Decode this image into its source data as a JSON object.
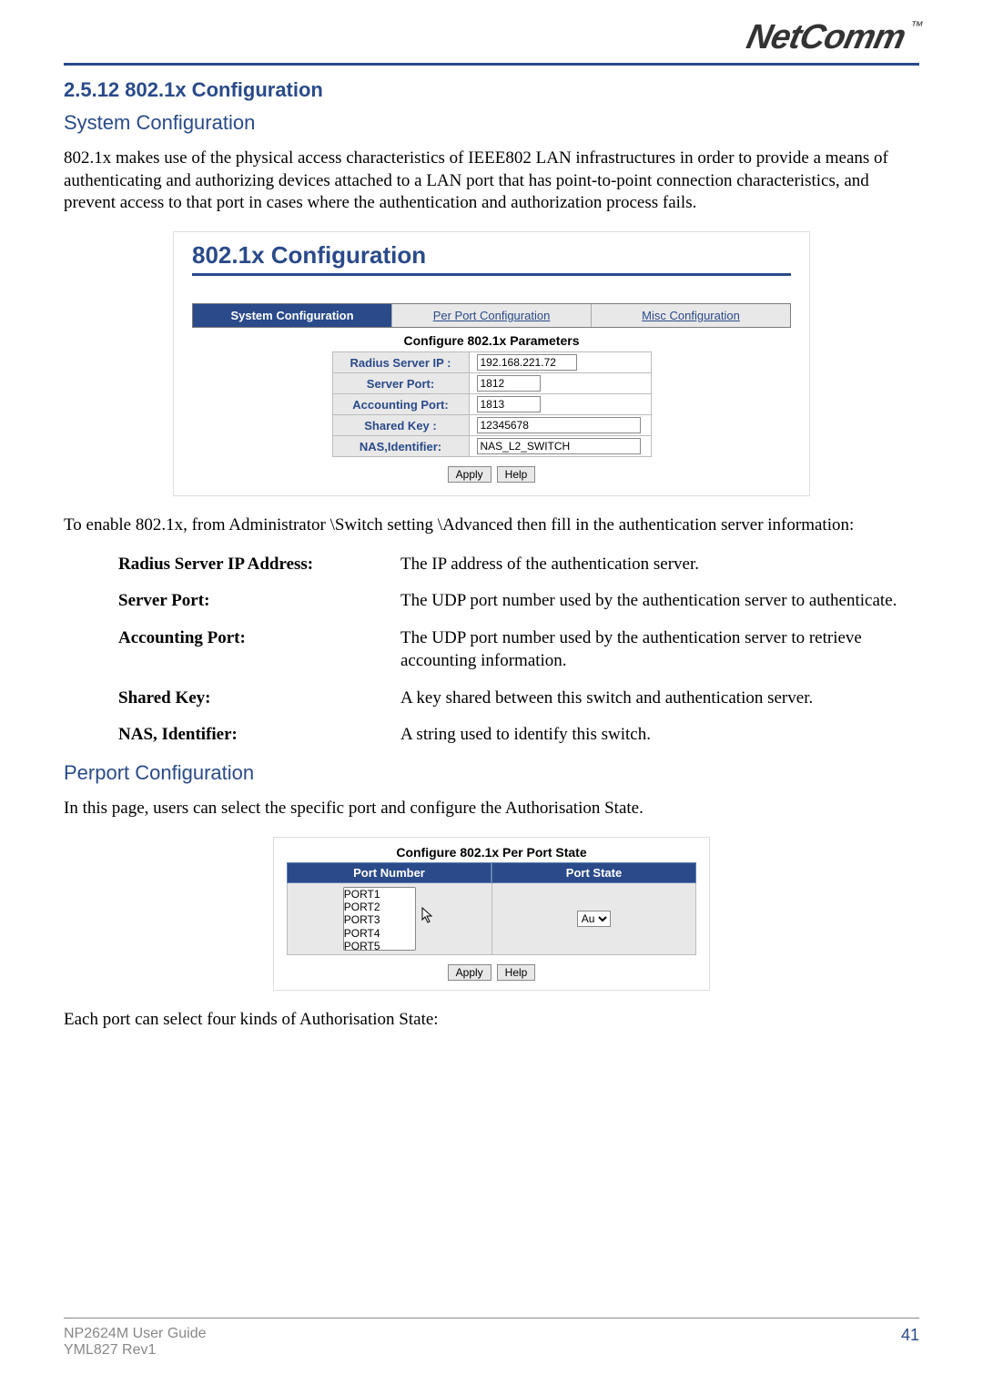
{
  "brand": {
    "name": "NetComm",
    "tm": "™"
  },
  "section": {
    "number_title": "2.5.12  802.1x Configuration"
  },
  "sys_config": {
    "heading": "System Configuration",
    "intro": "802.1x makes use of the physical access characteristics of IEEE802 LAN infrastructures in order to provide a means of authenticating and authorizing devices attached to a LAN port that has point-to-point connection characteristics, and prevent access to that port in cases where the authentication and authorization process fails.",
    "panel_title": "802.1x Configuration",
    "tabs": {
      "system": "System Configuration",
      "perport": "Per Port Configuration",
      "misc": "Misc Configuration"
    },
    "params_caption": "Configure 802.1x Parameters",
    "fields": {
      "radius_ip": {
        "label": "Radius Server IP :",
        "value": "192.168.221.72"
      },
      "server_port": {
        "label": "Server Port:",
        "value": "1812"
      },
      "accounting_port": {
        "label": "Accounting Port:",
        "value": "1813"
      },
      "shared_key": {
        "label": "Shared Key :",
        "value": "12345678"
      },
      "nas_identifier": {
        "label": "NAS,Identifier:",
        "value": "NAS_L2_SWITCH"
      }
    },
    "buttons": {
      "apply": "Apply",
      "help": "Help"
    },
    "post_text": "To enable 802.1x, from Administrator \\Switch setting \\Advanced then fill in the authentication server information:",
    "defs": [
      {
        "term": "Radius Server IP Address:",
        "desc": "The IP address of the authentication server."
      },
      {
        "term": "Server Port:",
        "desc": "The UDP port number used by the authentication server to authenticate."
      },
      {
        "term": "Accounting Port:",
        "desc": "The UDP port number used by the authentication server to retrieve accounting information."
      },
      {
        "term": "Shared Key:",
        "desc": "A key shared between this switch and authentication server."
      },
      {
        "term": "NAS, Identifier:",
        "desc": "A string used to identify this switch."
      }
    ]
  },
  "perport": {
    "heading": "Perport Configuration",
    "intro": "In this page, users can select the specific port and configure the Authorisation State.",
    "caption": "Configure 802.1x Per Port State",
    "col_port": "Port Number",
    "col_state": "Port State",
    "ports": [
      "PORT1",
      "PORT2",
      "PORT3",
      "PORT4",
      "PORT5"
    ],
    "state_value": "Au",
    "buttons": {
      "apply": "Apply",
      "help": "Help"
    },
    "post_text": "Each port can select four kinds of Authorisation State:"
  },
  "footer": {
    "guide": "NP2624M User Guide",
    "rev": "YML827 Rev1",
    "page": "41"
  }
}
